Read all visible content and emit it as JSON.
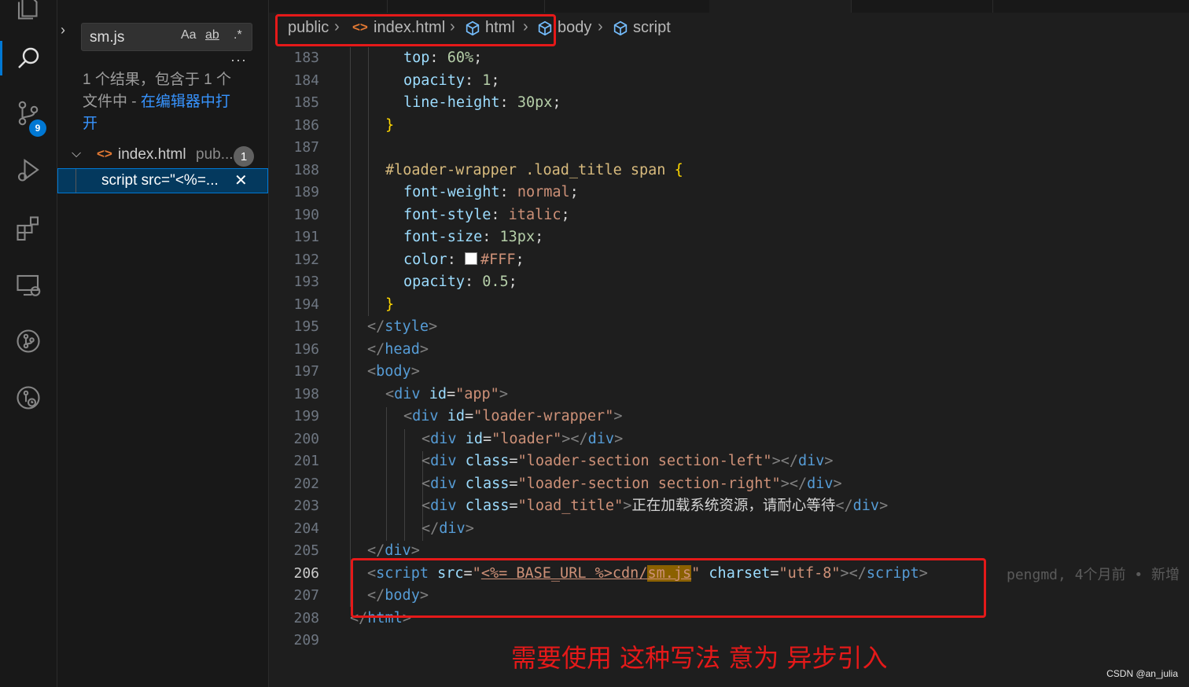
{
  "activity_bar": {
    "items": [
      "explorer",
      "search",
      "source-control",
      "run-debug",
      "extensions",
      "remote-explorer",
      "git-graph",
      "timeline"
    ],
    "scm_badge": "9"
  },
  "search": {
    "query": "sm.js",
    "match_case_label": "Aa",
    "whole_word_label": "ab",
    "regex_label": ".*",
    "more_label": "···",
    "result_summary": "1 个结果，包含于 1 个文件中 - ",
    "open_in_editor": "在编辑器中打开",
    "file": {
      "name": "index.html",
      "path": "pub...",
      "count": "1"
    },
    "match": {
      "text": "script src=\"<%=...",
      "close": "✕"
    }
  },
  "breadcrumb": {
    "items": [
      "public",
      "index.html",
      "html",
      "body",
      "script"
    ]
  },
  "editor": {
    "line_numbers": [
      "183",
      "184",
      "185",
      "186",
      "187",
      "188",
      "189",
      "190",
      "191",
      "192",
      "193",
      "194",
      "195",
      "196",
      "197",
      "198",
      "199",
      "200",
      "201",
      "202",
      "203",
      "204",
      "205",
      "206",
      "207",
      "208",
      "209"
    ],
    "current_line": "206",
    "blame": "pengmd, 4个月前 • 新增"
  },
  "annotation": "需要使用 这种写法  意为 异步引入",
  "watermark": "CSDN @an_julia",
  "colors": {
    "accent": "#0078d4",
    "annotation": "#e51919"
  }
}
